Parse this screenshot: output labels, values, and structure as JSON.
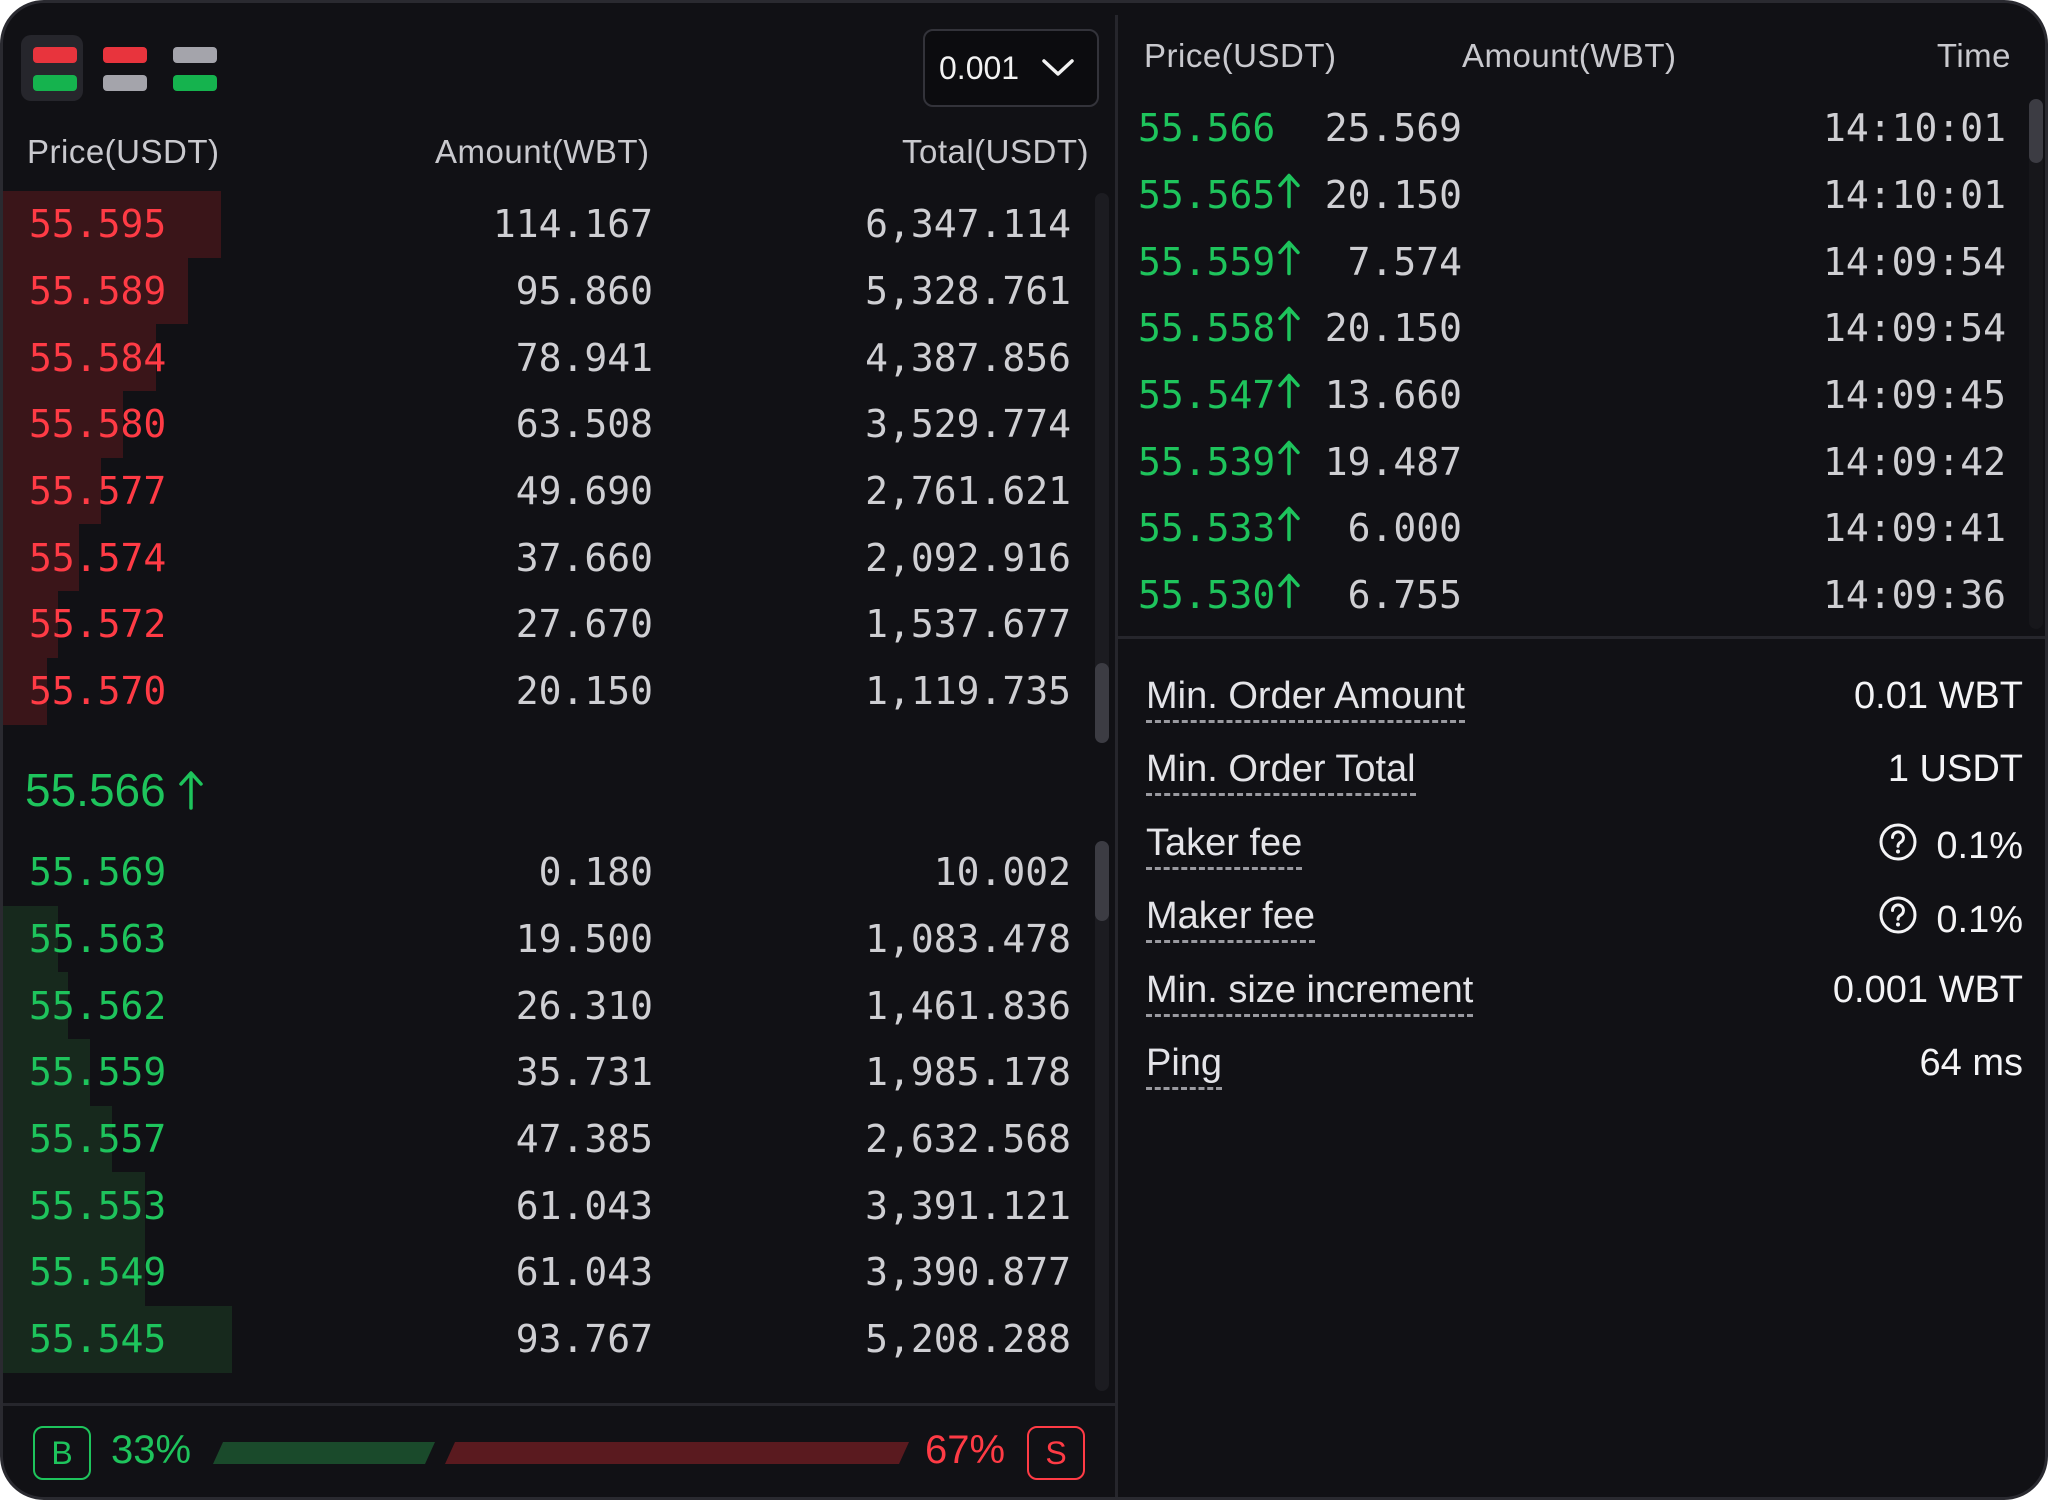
{
  "orderbook": {
    "precision": "0.001",
    "headers": {
      "price": "Price(USDT)",
      "amount": "Amount(WBT)",
      "total": "Total(USDT)"
    },
    "asks": [
      {
        "price": "55.595",
        "amount": "114.167",
        "total": "6,347.114",
        "depth": 0.2
      },
      {
        "price": "55.589",
        "amount": "95.860",
        "total": "5,328.761",
        "depth": 0.17
      },
      {
        "price": "55.584",
        "amount": "78.941",
        "total": "4,387.856",
        "depth": 0.14
      },
      {
        "price": "55.580",
        "amount": "63.508",
        "total": "3,529.774",
        "depth": 0.11
      },
      {
        "price": "55.577",
        "amount": "49.690",
        "total": "2,761.621",
        "depth": 0.09
      },
      {
        "price": "55.574",
        "amount": "37.660",
        "total": "2,092.916",
        "depth": 0.07
      },
      {
        "price": "55.572",
        "amount": "27.670",
        "total": "1,537.677",
        "depth": 0.05
      },
      {
        "price": "55.570",
        "amount": "20.150",
        "total": "1,119.735",
        "depth": 0.04
      }
    ],
    "mid_price": "55.566",
    "bids": [
      {
        "price": "55.569",
        "amount": "0.180",
        "total": "10.002",
        "depth": 0.0
      },
      {
        "price": "55.563",
        "amount": "19.500",
        "total": "1,083.478",
        "depth": 0.05
      },
      {
        "price": "55.562",
        "amount": "26.310",
        "total": "1,461.836",
        "depth": 0.06
      },
      {
        "price": "55.559",
        "amount": "35.731",
        "total": "1,985.178",
        "depth": 0.08
      },
      {
        "price": "55.557",
        "amount": "47.385",
        "total": "2,632.568",
        "depth": 0.1
      },
      {
        "price": "55.553",
        "amount": "61.043",
        "total": "3,391.121",
        "depth": 0.13
      },
      {
        "price": "55.549",
        "amount": "61.043",
        "total": "3,390.877",
        "depth": 0.13
      },
      {
        "price": "55.545",
        "amount": "93.767",
        "total": "5,208.288",
        "depth": 0.21
      }
    ],
    "ratio": {
      "buy_label": "B",
      "buy_pct": "33%",
      "sell_label": "S",
      "sell_pct": "67%"
    }
  },
  "trades": {
    "headers": {
      "price": "Price(USDT)",
      "amount": "Amount(WBT)",
      "time": "Time"
    },
    "rows": [
      {
        "price": "55.566",
        "amount": "25.569",
        "time": "14:10:01",
        "up": false
      },
      {
        "price": "55.565",
        "amount": "20.150",
        "time": "14:10:01",
        "up": true
      },
      {
        "price": "55.559",
        "amount": "7.574",
        "time": "14:09:54",
        "up": true
      },
      {
        "price": "55.558",
        "amount": "20.150",
        "time": "14:09:54",
        "up": true
      },
      {
        "price": "55.547",
        "amount": "13.660",
        "time": "14:09:45",
        "up": true
      },
      {
        "price": "55.539",
        "amount": "19.487",
        "time": "14:09:42",
        "up": true
      },
      {
        "price": "55.533",
        "amount": "6.000",
        "time": "14:09:41",
        "up": true
      },
      {
        "price": "55.530",
        "amount": "6.755",
        "time": "14:09:36",
        "up": true
      }
    ]
  },
  "info": [
    {
      "label": "Min. Order Amount",
      "value": "0.01 WBT",
      "help": false
    },
    {
      "label": "Min. Order Total",
      "value": "1 USDT",
      "help": false
    },
    {
      "label": "Taker fee",
      "value": "0.1%",
      "help": true
    },
    {
      "label": "Maker fee",
      "value": "0.1%",
      "help": true
    },
    {
      "label": "Min. size increment",
      "value": "0.001 WBT",
      "help": false
    },
    {
      "label": "Ping",
      "value": "64 ms",
      "help": false
    }
  ],
  "colors": {
    "ask": "#ff3b45",
    "bid": "#1ec45c",
    "background": "#111115"
  },
  "icons": [
    "view-both-icon",
    "view-asks-icon",
    "view-bids-icon",
    "chevron-down-icon",
    "arrow-up-icon",
    "question-circle-icon"
  ]
}
